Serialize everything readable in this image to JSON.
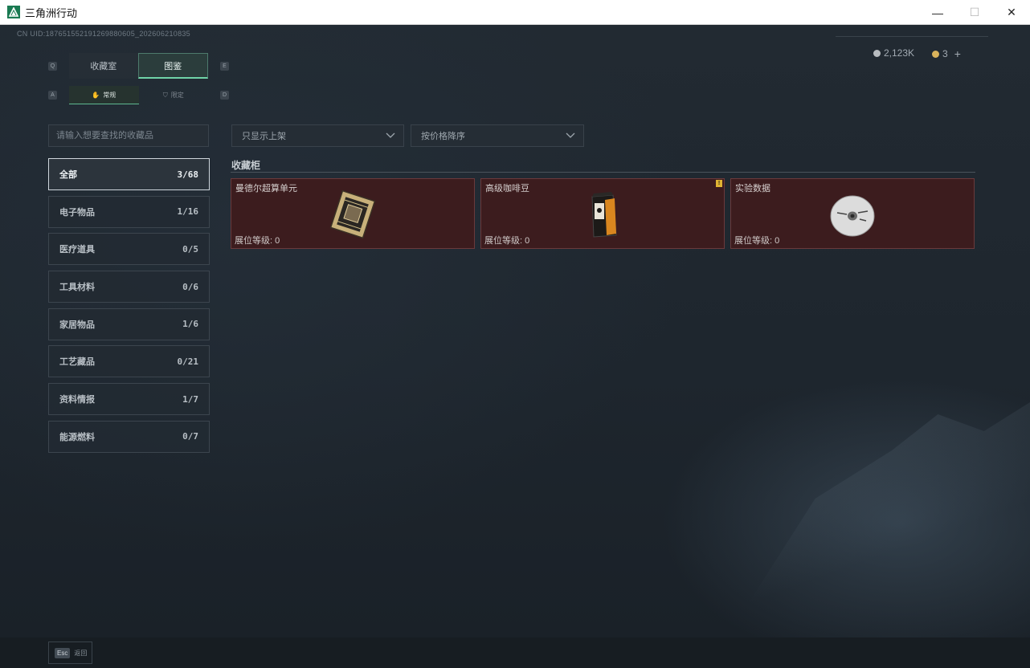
{
  "window": {
    "title": "三角洲行动",
    "minimize": "—",
    "maximize": "☐",
    "close": "✕"
  },
  "header": {
    "uid": "CN UID:187651552191269880605_202606210835",
    "currency": [
      {
        "icon": "silver-coin-icon",
        "value": "2,123K"
      },
      {
        "icon": "gold-coin-icon",
        "value": "3"
      }
    ],
    "add_label": "+"
  },
  "tabs": {
    "hotkey_left": "Q",
    "hotkey_right": "E",
    "items": [
      {
        "label": "收藏室",
        "active": false
      },
      {
        "label": "图鉴",
        "active": true
      }
    ]
  },
  "subtabs": {
    "hotkey_left": "A",
    "hotkey_right": "D",
    "items": [
      {
        "label": "常规",
        "icon": "hand-icon",
        "active": true
      },
      {
        "label": "限定",
        "icon": "limited-icon",
        "active": false
      }
    ]
  },
  "search": {
    "placeholder": "请输入想要查找的收藏品"
  },
  "categories": [
    {
      "label": "全部",
      "count": "3/68",
      "active": true
    },
    {
      "label": "电子物品",
      "count": "1/16",
      "active": false
    },
    {
      "label": "医疗道具",
      "count": "0/5",
      "active": false
    },
    {
      "label": "工具材料",
      "count": "0/6",
      "active": false
    },
    {
      "label": "家居物品",
      "count": "1/6",
      "active": false
    },
    {
      "label": "工艺藏品",
      "count": "0/21",
      "active": false
    },
    {
      "label": "资料情报",
      "count": "1/7",
      "active": false
    },
    {
      "label": "能源燃料",
      "count": "0/7",
      "active": false
    }
  ],
  "filters": {
    "shelf": "只显示上架",
    "sort": "按价格降序"
  },
  "section": {
    "title": "收藏柜"
  },
  "items": [
    {
      "name": "曼德尔超算单元",
      "level": "展位等级: 0",
      "icon": "computing-unit-icon",
      "badge": ""
    },
    {
      "name": "高级咖啡豆",
      "level": "展位等级: 0",
      "icon": "coffee-bag-icon",
      "badge": "!"
    },
    {
      "name": "实验数据",
      "level": "展位等级: 0",
      "icon": "data-disc-icon",
      "badge": ""
    }
  ],
  "footer": {
    "esc_key": "Esc",
    "esc_label": "返回"
  },
  "colors": {
    "accent": "#6fd4a8",
    "card_bg": "#3c1c1e",
    "badge": "#e0b433"
  }
}
